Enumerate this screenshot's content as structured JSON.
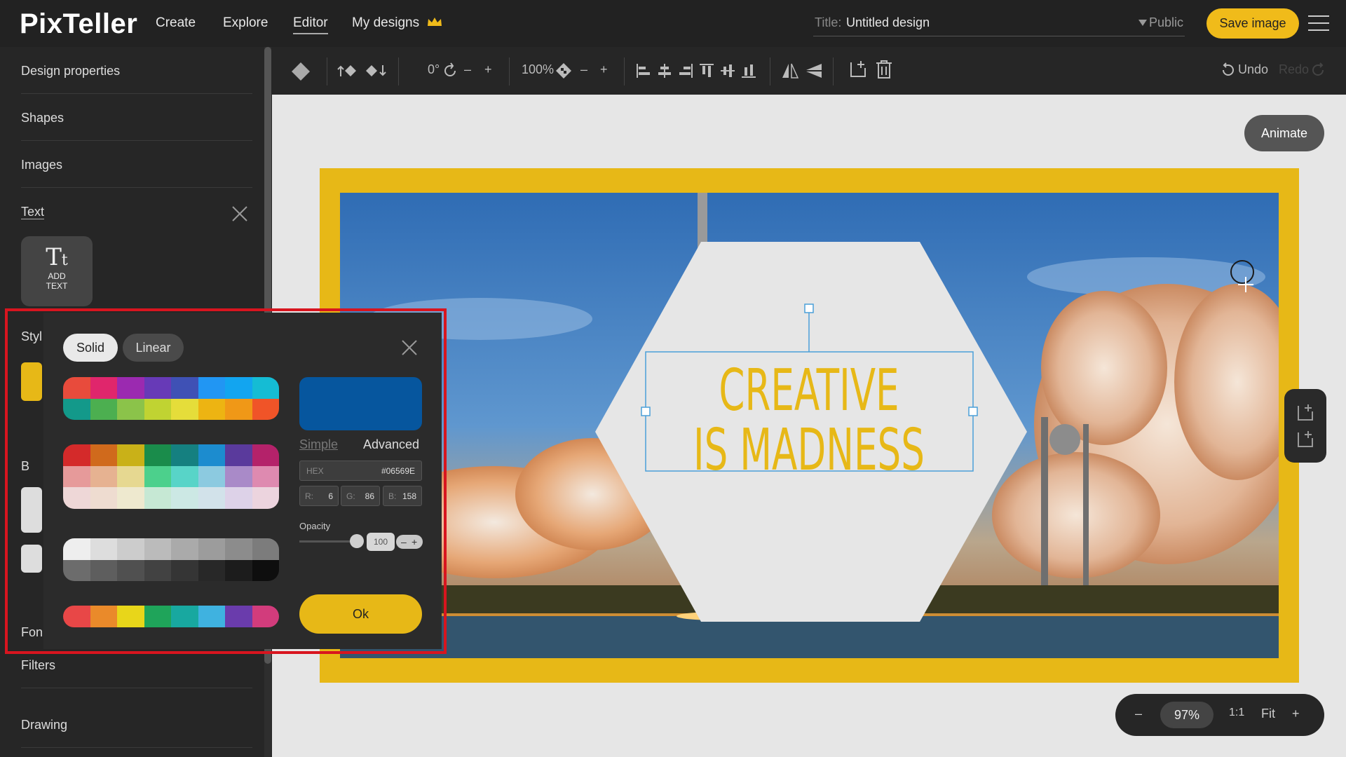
{
  "app": {
    "logo": "PixTeller"
  },
  "nav": [
    {
      "label": "Create"
    },
    {
      "label": "Explore"
    },
    {
      "label": "Editor"
    },
    {
      "label": "My designs"
    }
  ],
  "title_bar": {
    "label": "Title:",
    "value": "Untitled design",
    "visibility": "Public"
  },
  "save_button": "Save image",
  "sidebar": {
    "items": [
      {
        "label": "Design properties"
      },
      {
        "label": "Shapes"
      },
      {
        "label": "Images"
      },
      {
        "label": "Text"
      }
    ],
    "add_text": {
      "line1": "ADD",
      "line2": "TEXT"
    },
    "partial_labels": {
      "style": "Styl",
      "bold": "B",
      "font": "Fon"
    },
    "lower_items": [
      {
        "label": "Filters"
      },
      {
        "label": "Drawing"
      }
    ]
  },
  "toolbar": {
    "rotation": "0°",
    "zoom": "100%",
    "undo": "Undo",
    "redo": "Redo"
  },
  "canvas": {
    "animate_button": "Animate",
    "text_line1": "CREATIVE",
    "text_line2": "IS MADNESS",
    "frame_color": "#e7b817",
    "text_color": "#e7b817"
  },
  "zoom_controls": {
    "minus": "–",
    "value": "97%",
    "ratio": "1:1",
    "fit": "Fit",
    "plus": "+"
  },
  "color_picker": {
    "tabs": {
      "solid": "Solid",
      "linear": "Linear"
    },
    "modes": {
      "simple": "Simple",
      "advanced": "Advanced"
    },
    "preview_color": "#06569E",
    "hex": {
      "label": "HEX",
      "value": "#06569E"
    },
    "rgb": [
      {
        "label": "R:",
        "value": "6"
      },
      {
        "label": "G:",
        "value": "86"
      },
      {
        "label": "B:",
        "value": "158"
      }
    ],
    "opacity": {
      "label": "Opacity",
      "value": "100"
    },
    "ok": "Ok",
    "palettes": [
      [
        [
          "#e84b3c",
          "#e0266c",
          "#9b2ab0",
          "#673ab7",
          "#3f51b5",
          "#2196f3",
          "#12a5f0",
          "#15bcd4"
        ],
        [
          "#13998a",
          "#4caf50",
          "#8bc34a",
          "#c0d332",
          "#e5dd3a",
          "#edb412",
          "#f09817",
          "#f05428"
        ]
      ],
      [
        [
          "#d42a2a",
          "#d06a1c",
          "#c9b118",
          "#1a8c4b",
          "#158080",
          "#1c8ccf",
          "#5a3a9c",
          "#b4226a"
        ],
        [
          "#e69a9a",
          "#e6b291",
          "#e6d891",
          "#4cd08c",
          "#58d4c8",
          "#8ccae0",
          "#a98ac8",
          "#de8ab0"
        ],
        [
          "#eed7d7",
          "#eedcd0",
          "#eee9cf",
          "#c6e8d4",
          "#cce8e4",
          "#d2e2ea",
          "#ddd2e8",
          "#ecd4de"
        ]
      ],
      [
        [
          "#eeeeee",
          "#dddddd",
          "#cccccc",
          "#bbbbbb",
          "#aaaaaa",
          "#9c9c9c",
          "#8c8c8c",
          "#7c7c7c"
        ],
        [
          "#6c6c6c",
          "#5e5e5e",
          "#505050",
          "#424242",
          "#353535",
          "#282828",
          "#1c1c1c",
          "#0e0e0e"
        ]
      ],
      [
        [
          "#e84747",
          "#ea8a2a",
          "#e8d61a",
          "#1fa45a",
          "#18a8a0",
          "#3fb2e0",
          "#6a3cac",
          "#d23c7c"
        ]
      ]
    ]
  }
}
